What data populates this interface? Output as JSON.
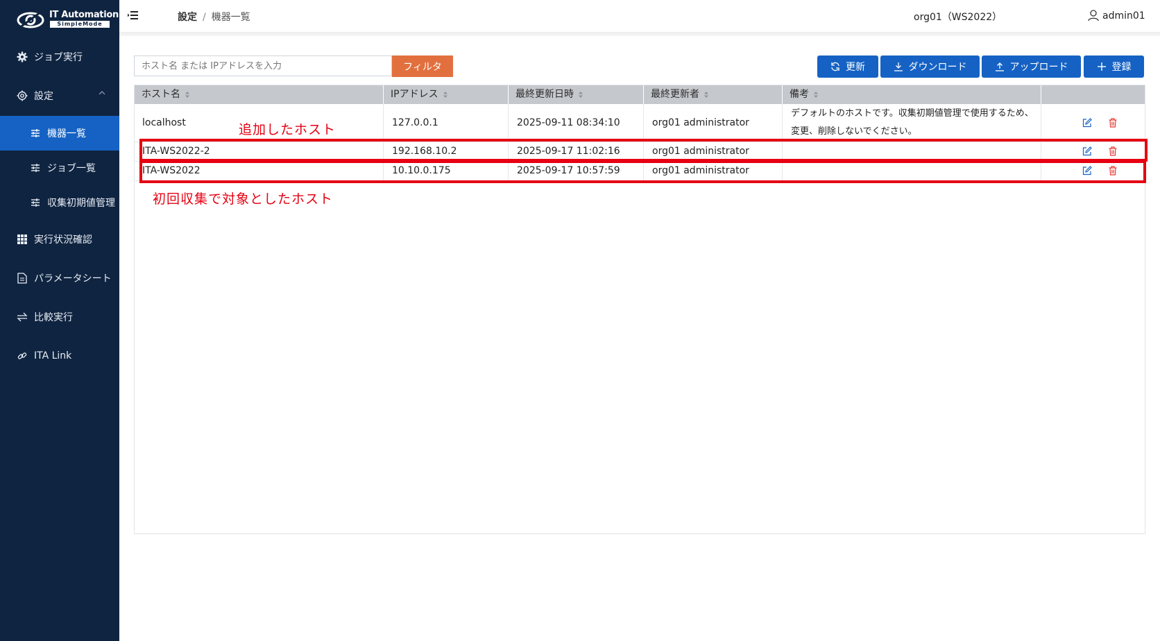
{
  "logo": {
    "title": "IT Automation",
    "subtitle": "SimpleMode"
  },
  "sidebar": {
    "items": [
      {
        "label": "ジョブ実行",
        "icon": "gear-icon"
      },
      {
        "label": "設定",
        "icon": "settings-icon"
      },
      {
        "label": "機器一覧",
        "icon": "sliders-icon"
      },
      {
        "label": "ジョブ一覧",
        "icon": "sliders-icon"
      },
      {
        "label": "収集初期値管理",
        "icon": "sliders-icon"
      },
      {
        "label": "実行状況確認",
        "icon": "grid-icon"
      },
      {
        "label": "パラメータシート",
        "icon": "document-icon"
      },
      {
        "label": "比較実行",
        "icon": "compare-icon"
      },
      {
        "label": "ITA Link",
        "icon": "link-icon"
      }
    ]
  },
  "header": {
    "breadcrumb": [
      "設定",
      "機器一覧"
    ],
    "breadcrumb_sep": "/",
    "org": "org01（WS2022）",
    "user": "admin01"
  },
  "toolbar": {
    "search_placeholder": "ホスト名 または IPアドレスを入力",
    "filter_label": "フィルタ",
    "refresh_label": "更新",
    "download_label": "ダウンロード",
    "upload_label": "アップロード",
    "register_label": "登録"
  },
  "table": {
    "columns": [
      "ホスト名",
      "IPアドレス",
      "最終更新日時",
      "最終更新者",
      "備考"
    ],
    "rows": [
      {
        "host": "localhost",
        "ip": "127.0.0.1",
        "updated": "2025-09-11 08:34:10",
        "updater": "org01 administrator",
        "note": "デフォルトのホストです。収集初期値管理で使用するため、変更、削除しないでください。"
      },
      {
        "host": "ITA-WS2022-2",
        "ip": "192.168.10.2",
        "updated": "2025-09-17 11:02:16",
        "updater": "org01 administrator",
        "note": ""
      },
      {
        "host": "ITA-WS2022",
        "ip": "10.10.0.175",
        "updated": "2025-09-17 10:57:59",
        "updater": "org01 administrator",
        "note": ""
      }
    ]
  },
  "annotations": {
    "added_host": "追加したホスト",
    "initial_host": "初回収集で対象としたホスト",
    "color": "#e60012"
  },
  "colors": {
    "sidebar": "#0f2440",
    "accent": "#1562c4",
    "filter": "#e2703f",
    "delete": "#e53935"
  }
}
